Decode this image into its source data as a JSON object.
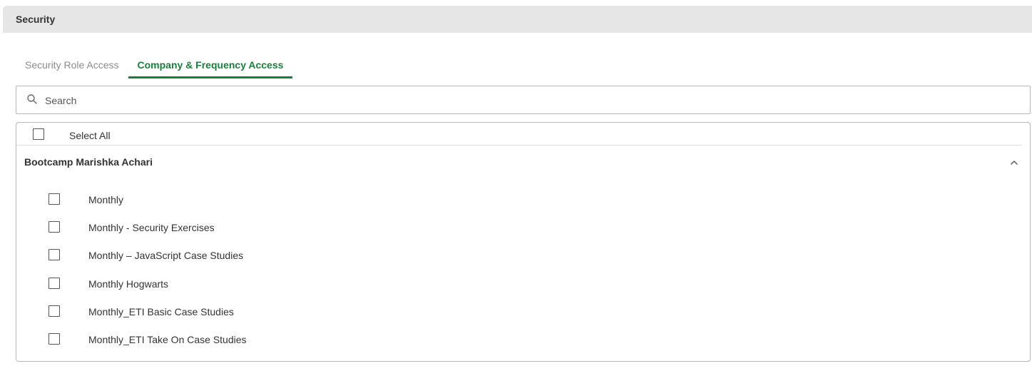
{
  "header": {
    "title": "Security"
  },
  "tabs": [
    {
      "label": "Security Role Access",
      "active": false
    },
    {
      "label": "Company & Frequency Access",
      "active": true
    }
  ],
  "search": {
    "placeholder": "Search",
    "value": ""
  },
  "list": {
    "select_all_label": "Select All",
    "group": {
      "title": "Bootcamp Marishka Achari",
      "expanded": true,
      "items": [
        {
          "label": "Monthly",
          "checked": false
        },
        {
          "label": "Monthly - Security Exercises",
          "checked": false
        },
        {
          "label": "Monthly – JavaScript Case Studies",
          "checked": false
        },
        {
          "label": "Monthly Hogwarts",
          "checked": false
        },
        {
          "label": "Monthly_ETI Basic Case Studies",
          "checked": false
        },
        {
          "label": "Monthly_ETI Take On Case Studies",
          "checked": false
        }
      ]
    }
  },
  "colors": {
    "accent": "#1a7f3c",
    "header_bg": "#e6e6e6",
    "border": "#b8b8b8"
  }
}
